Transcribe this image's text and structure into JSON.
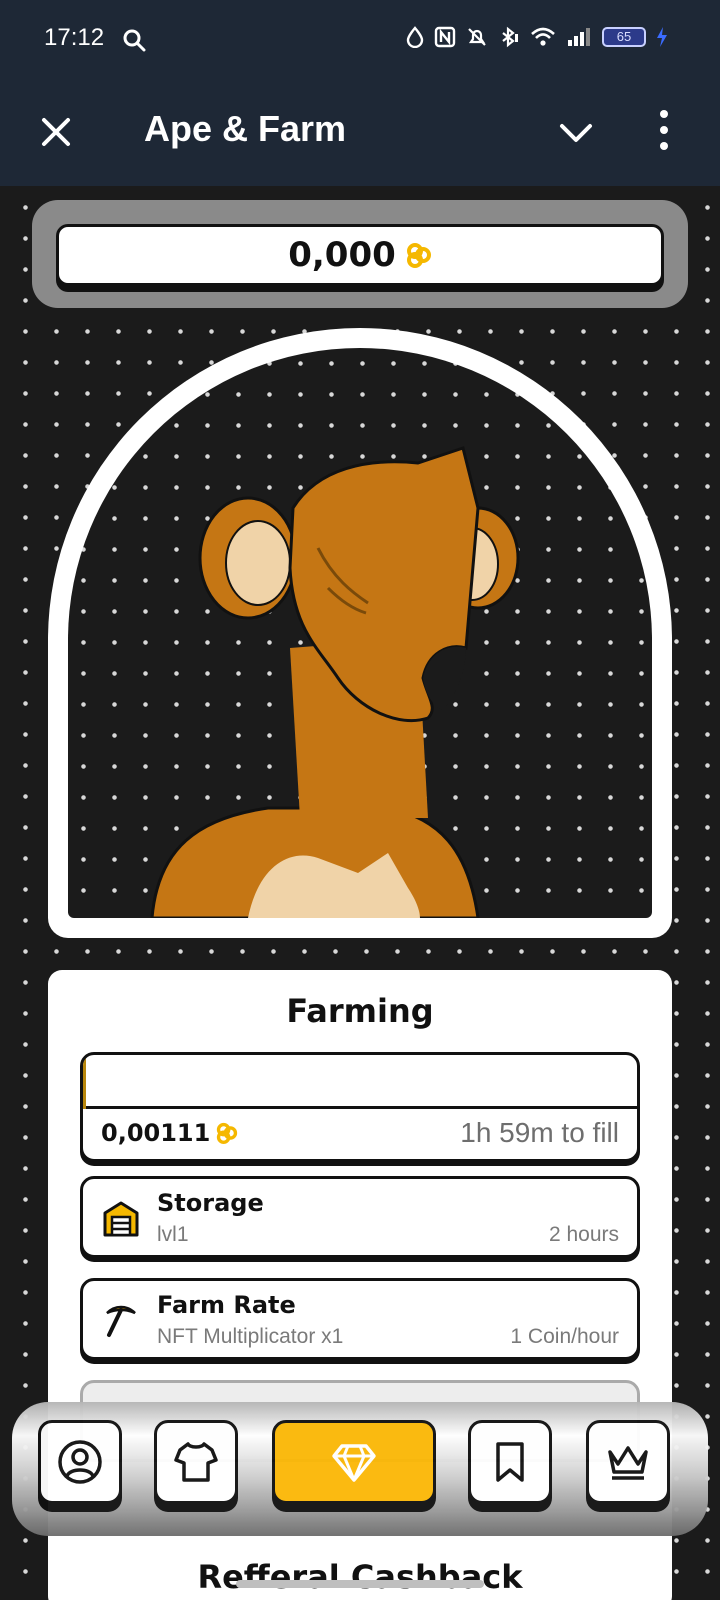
{
  "status_bar": {
    "time": "17:12",
    "battery": "65"
  },
  "app_bar": {
    "title": "Ape & Farm"
  },
  "balance": {
    "value": "0,000"
  },
  "farming": {
    "title": "Farming",
    "progress_fraction": 0.004,
    "amount": "0,00111",
    "time_to_fill": "1h 59m to fill",
    "storage": {
      "title": "Storage",
      "level": "lvl1",
      "capacity": "2 hours"
    },
    "farm_rate": {
      "title": "Farm Rate",
      "subtitle": "NFT Multiplicator x1",
      "rate": "1 Coin/hour"
    },
    "referral_title": "Refferal Cashback"
  },
  "colors": {
    "accent": "#fbb808",
    "coin": "#f5b800",
    "header_bg": "#1e2836",
    "ape_fur": "#c57614"
  },
  "bottom_nav": {
    "items": [
      {
        "icon": "profile-icon"
      },
      {
        "icon": "shirt-icon"
      },
      {
        "icon": "diamond-icon",
        "active": true
      },
      {
        "icon": "bookmark-icon"
      },
      {
        "icon": "crown-icon"
      }
    ]
  }
}
